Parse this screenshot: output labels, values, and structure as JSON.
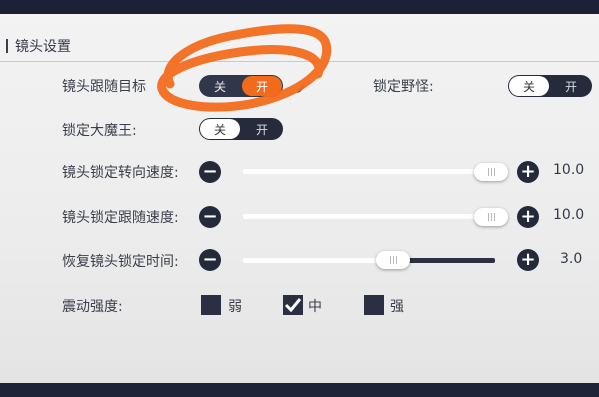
{
  "settings": {
    "title": "镜头设置",
    "camera_follow": {
      "label": "镜头跟随目标",
      "off": "关",
      "on": "开",
      "selected": "开"
    },
    "lock_monster": {
      "label": "锁定野怪:",
      "off": "关",
      "on": "开",
      "selected": "关"
    },
    "lock_boss": {
      "label": "锁定大魔王:",
      "off": "关",
      "on": "开",
      "selected": "关"
    },
    "sliders": [
      {
        "label": "镜头锁定转向速度:",
        "value": "10.0",
        "level": 1.0
      },
      {
        "label": "镜头锁定跟随速度:",
        "value": "10.0",
        "level": 1.0
      },
      {
        "label": "恢复镜头锁定时间:",
        "value": "3.0",
        "level": 0.6
      }
    ],
    "vibration": {
      "label": "震动强度:",
      "options": [
        "弱",
        "中",
        "强"
      ],
      "selected": "中"
    }
  },
  "colors": {
    "accent_orange": "#f26b1d",
    "dark": "#252b3b"
  }
}
